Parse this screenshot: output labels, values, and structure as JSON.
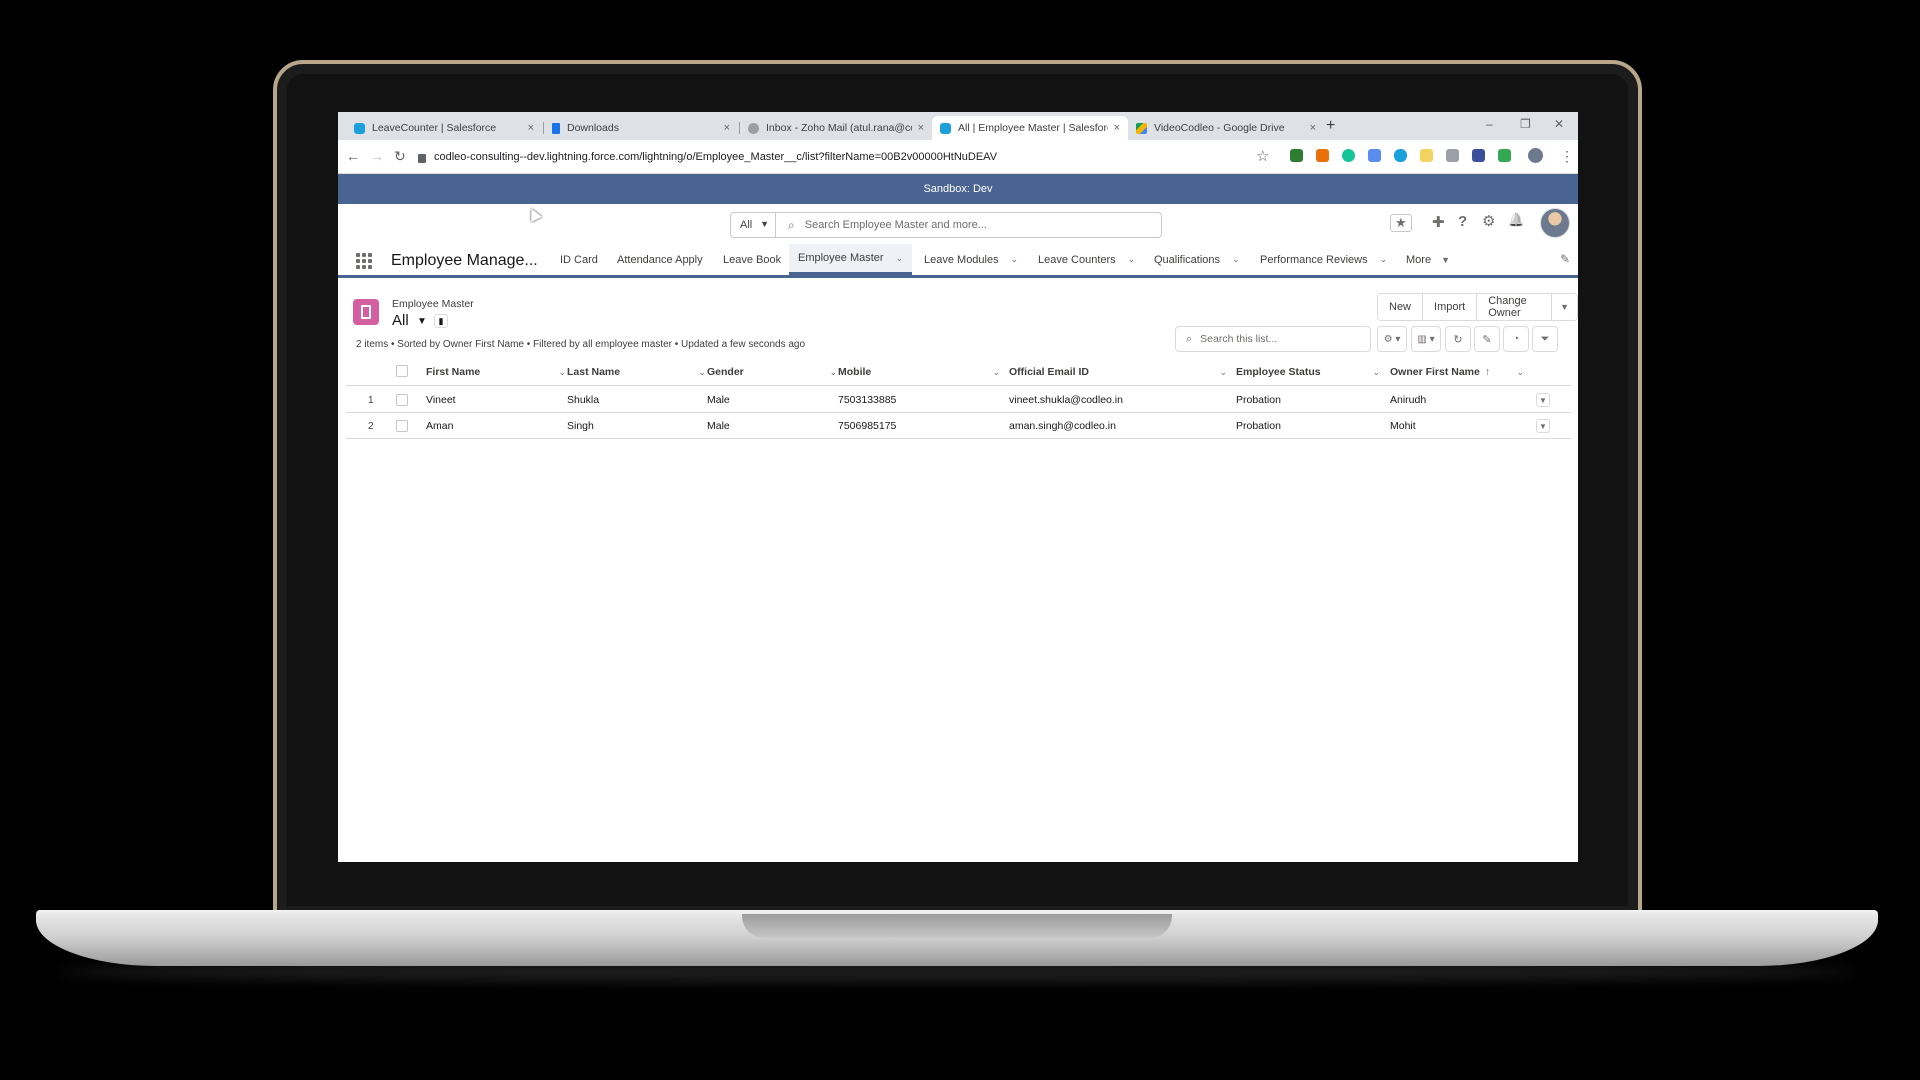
{
  "browser": {
    "tabs": [
      {
        "title": "LeaveCounter | Salesforce",
        "favicon_color": "#1ba0dc",
        "active": false
      },
      {
        "title": "Downloads",
        "favicon_color": "#1a73e8",
        "active": false
      },
      {
        "title": "Inbox - Zoho Mail (atul.rana@co",
        "favicon_color": "#9aa0a6",
        "active": false
      },
      {
        "title": "All | Employee Master | Salesforc",
        "favicon_color": "#1ba0dc",
        "active": true
      },
      {
        "title": "VideoCodleo - Google Drive",
        "favicon_color": "#f4b400",
        "active": false
      }
    ],
    "tab_close": "×",
    "new_tab": "+",
    "window_controls": {
      "minimize": "–",
      "restore": "❐",
      "close": "✕"
    },
    "url": "codleo-consulting--dev.lightning.force.com/lightning/o/Employee_Master__c/list?filterName=00B2v00000HtNuDEAV",
    "nav": {
      "back": "←",
      "forward": "→",
      "reload": "↻"
    },
    "star": "☆",
    "menu": "⋮"
  },
  "banner": {
    "text": "Sandbox: Dev"
  },
  "header": {
    "scope": "All",
    "search_placeholder": "Search Employee Master and more...",
    "icons": {
      "favorites": "★",
      "add": "✚",
      "help": "?",
      "settings": "⚙",
      "notifications": "🔔"
    }
  },
  "nav": {
    "app_name": "Employee Manage...",
    "items": [
      {
        "label": "ID Card",
        "dropdown": false
      },
      {
        "label": "Attendance Apply",
        "dropdown": false
      },
      {
        "label": "Leave Book",
        "dropdown": false
      },
      {
        "label": "Employee Master",
        "dropdown": true,
        "active": true
      },
      {
        "label": "Leave Modules",
        "dropdown": true
      },
      {
        "label": "Leave Counters",
        "dropdown": true
      },
      {
        "label": "Qualifications",
        "dropdown": true
      },
      {
        "label": "Performance Reviews",
        "dropdown": true
      },
      {
        "label": "More",
        "dropdown": true
      }
    ],
    "chevron": "⌄",
    "edit": "✎"
  },
  "list": {
    "object_label": "Employee Master",
    "view_name": "All",
    "caret": "▼",
    "pin": "📌",
    "buttons": {
      "new": "New",
      "import": "Import",
      "change_owner": "Change Owner",
      "more": "▼"
    },
    "meta": "2 items • Sorted by Owner First Name • Filtered by all employee master • Updated a few seconds ago",
    "search_placeholder": "Search this list...",
    "toolbar": {
      "settings": "⚙ ▾",
      "display": "▥ ▾",
      "refresh": "↻",
      "edit": "✎",
      "chart": "◔",
      "filter": "⏷"
    },
    "columns": [
      {
        "label": "First Name"
      },
      {
        "label": "Last Name"
      },
      {
        "label": "Gender"
      },
      {
        "label": "Mobile"
      },
      {
        "label": "Official Email ID"
      },
      {
        "label": "Employee Status"
      },
      {
        "label": "Owner First Name",
        "sorted": "↑"
      }
    ],
    "rows": [
      {
        "num": "1",
        "first": "Vineet",
        "last": "Shukla",
        "gender": "Male",
        "mobile": "7503133885",
        "email": "vineet.shukla@codleo.in",
        "status": "Probation",
        "owner": "Anirudh"
      },
      {
        "num": "2",
        "first": "Aman",
        "last": "Singh",
        "gender": "Male",
        "mobile": "7506985175",
        "email": "aman.singh@codleo.in",
        "status": "Probation",
        "owner": "Mohit"
      }
    ],
    "row_menu": "▼"
  }
}
